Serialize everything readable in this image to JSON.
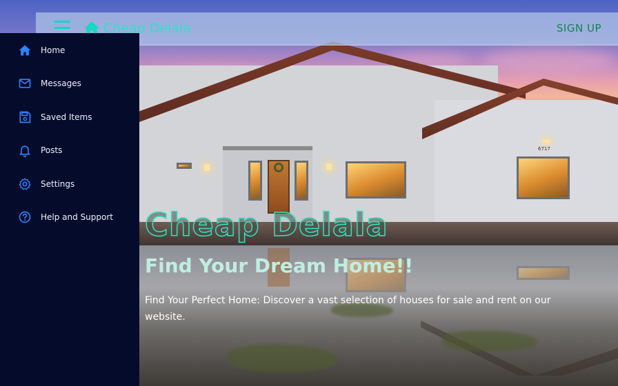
{
  "colors": {
    "accent": "#17d6c4",
    "brand_text": "#2fe0cb",
    "signup": "#14854f",
    "sidebar_bg": "#050b2b",
    "nav_icon": "#2f82ff"
  },
  "header": {
    "brand_name": "Cheap Delala",
    "brand_icon": "home-icon",
    "menu_icon": "hamburger-menu-icon",
    "signup_label": "SIGN UP"
  },
  "sidebar": {
    "items": [
      {
        "label": "Home",
        "icon": "home-icon"
      },
      {
        "label": "Messages",
        "icon": "mail-icon"
      },
      {
        "label": "Saved Items",
        "icon": "save-icon"
      },
      {
        "label": "Posts",
        "icon": "bell-icon"
      },
      {
        "label": "Settings",
        "icon": "gear-icon"
      },
      {
        "label": "Help and Support",
        "icon": "help-icon"
      }
    ]
  },
  "hero": {
    "title": "Cheap Delala",
    "subtitle": "Find Your Dream Home!!",
    "description": "Find Your Perfect Home: Discover a vast selection of houses for sale and rent on our website.",
    "house_number": "6717"
  }
}
